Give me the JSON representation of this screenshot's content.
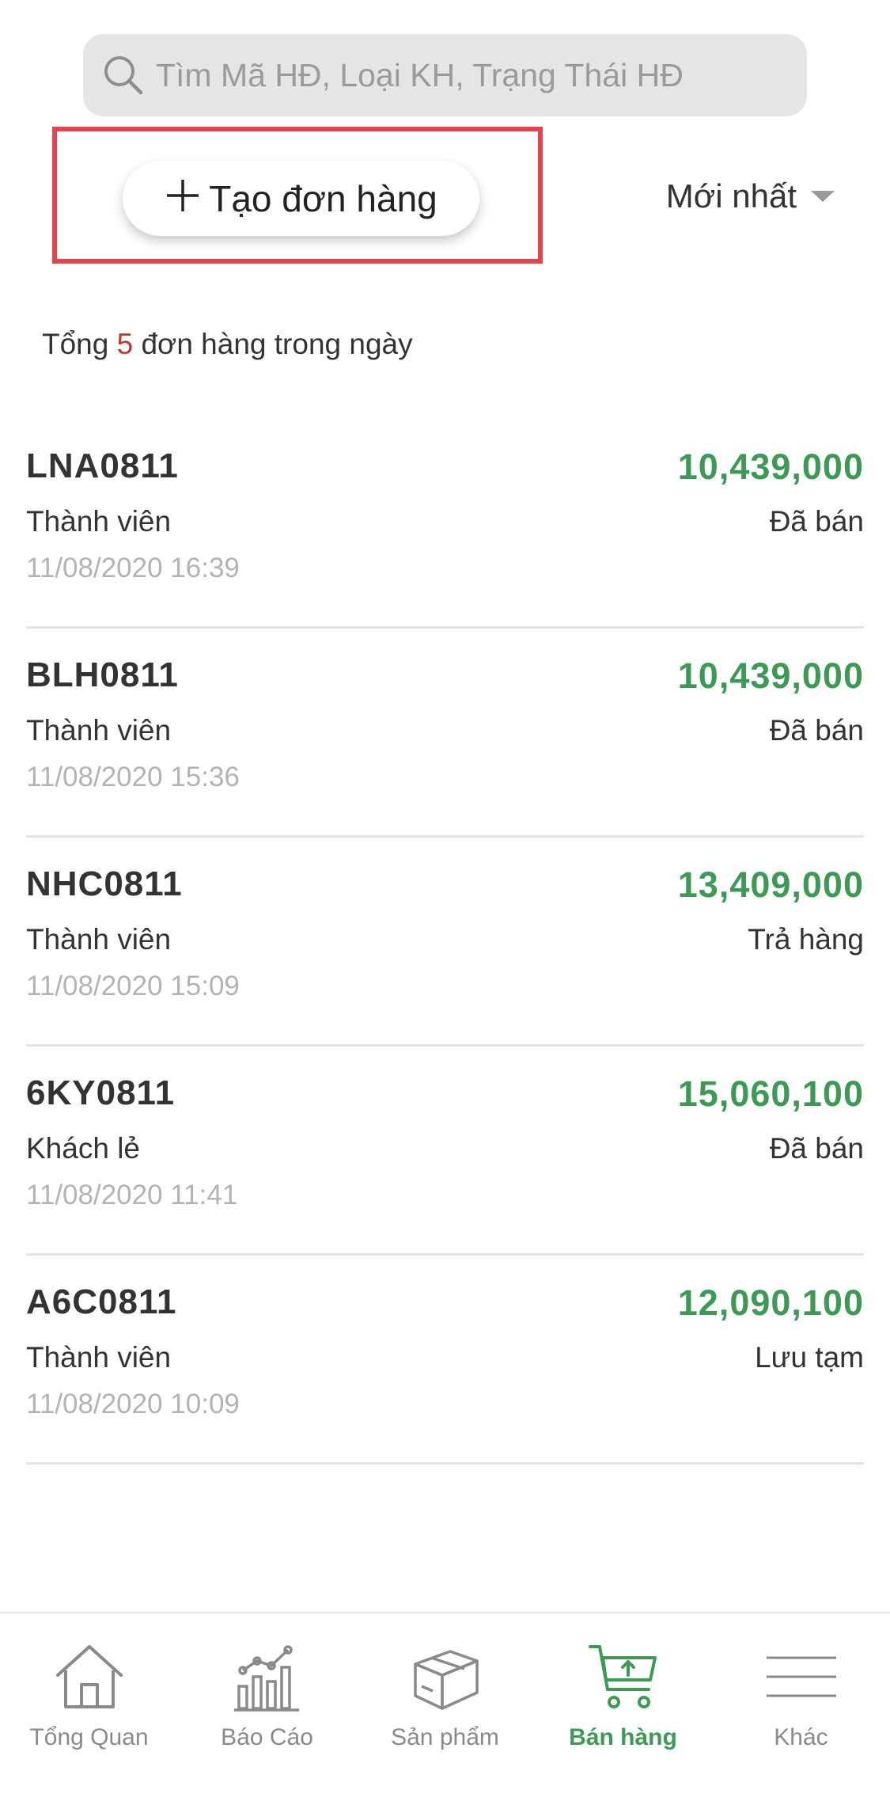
{
  "search": {
    "placeholder": "Tìm Mã HĐ, Loại KH, Trạng Thái HĐ"
  },
  "toolbar": {
    "create_label": "Tạo đơn hàng",
    "sort_label": "Mới nhất"
  },
  "summary": {
    "prefix": "Tổng ",
    "count": "5",
    "suffix": " đơn hàng trong ngày"
  },
  "orders": [
    {
      "code": "LNA0811",
      "customer": "Thành viên",
      "time": "11/08/2020 16:39",
      "amount": "10,439,000",
      "status": "Đã bán"
    },
    {
      "code": "BLH0811",
      "customer": "Thành viên",
      "time": "11/08/2020 15:36",
      "amount": "10,439,000",
      "status": "Đã bán"
    },
    {
      "code": "NHC0811",
      "customer": "Thành viên",
      "time": "11/08/2020 15:09",
      "amount": "13,409,000",
      "status": "Trả hàng"
    },
    {
      "code": "6KY0811",
      "customer": "Khách lẻ",
      "time": "11/08/2020 11:41",
      "amount": "15,060,100",
      "status": "Đã bán"
    },
    {
      "code": "A6C0811",
      "customer": "Thành viên",
      "time": "11/08/2020 10:09",
      "amount": "12,090,100",
      "status": "Lưu tạm"
    }
  ],
  "nav": [
    {
      "label": "Tổng Quan",
      "icon": "home-icon",
      "active": false
    },
    {
      "label": "Báo Cáo",
      "icon": "chart-icon",
      "active": false
    },
    {
      "label": "Sản phẩm",
      "icon": "box-icon",
      "active": false
    },
    {
      "label": "Bán hàng",
      "icon": "cart-icon",
      "active": true
    },
    {
      "label": "Khác",
      "icon": "menu-icon",
      "active": false
    }
  ],
  "colors": {
    "accent": "#3c9a55",
    "highlight": "#e2434f",
    "count": "#c0392b"
  }
}
